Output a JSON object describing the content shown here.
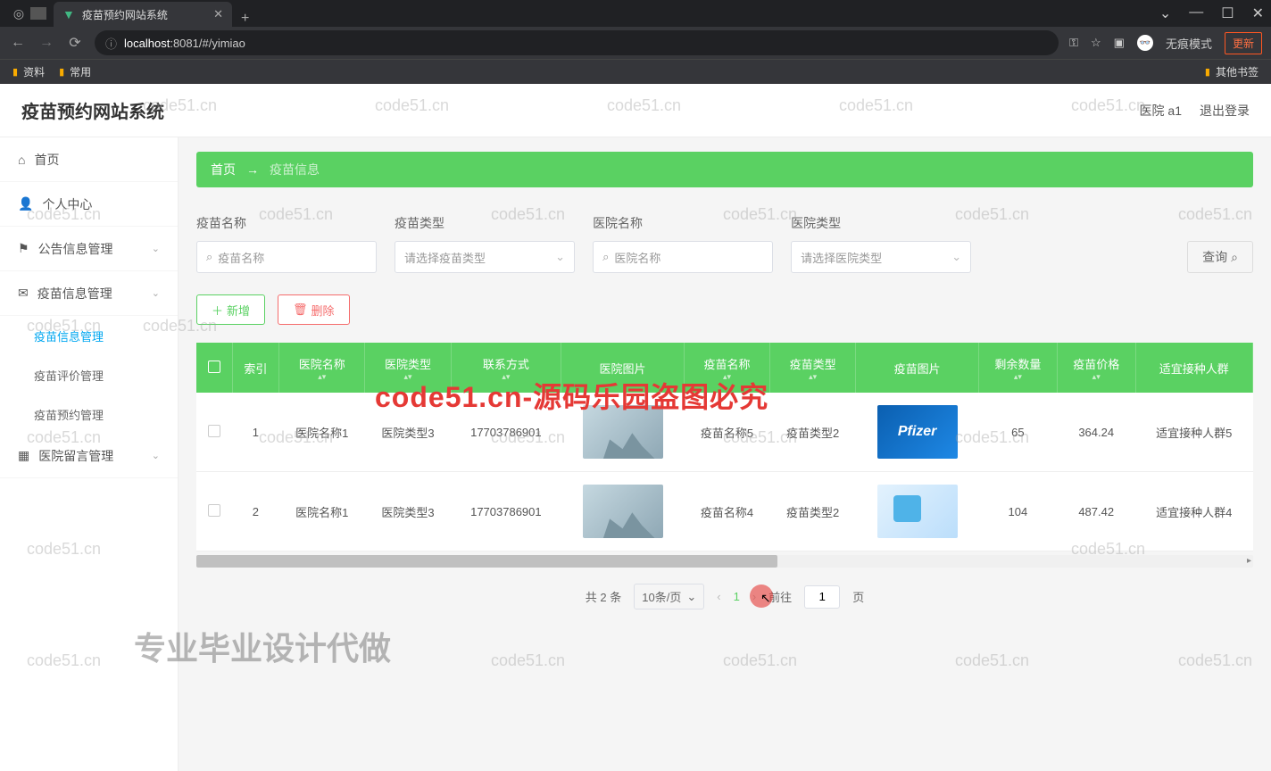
{
  "browser": {
    "tab_title": "疫苗预约网站系统",
    "url_prefix": "localhost",
    "url_port": ":8081",
    "url_path": "/#/yimiao",
    "incognito_label": "无痕模式",
    "update_label": "更新",
    "bookmarks": [
      "资料",
      "常用"
    ],
    "bookmark_other": "其他书签"
  },
  "header": {
    "title": "疫苗预约网站系统",
    "user": "医院 a1",
    "logout": "退出登录"
  },
  "sidebar": {
    "items": [
      {
        "icon": "⌂",
        "label": "首页"
      },
      {
        "icon": "👤",
        "label": "个人中心"
      },
      {
        "icon": "⚑",
        "label": "公告信息管理",
        "expand": true
      },
      {
        "icon": "✉",
        "label": "疫苗信息管理",
        "expand": true,
        "children": [
          "疫苗信息管理",
          "疫苗评价管理",
          "疫苗预约管理"
        ],
        "active_child": 0
      },
      {
        "icon": "▦",
        "label": "医院留言管理",
        "expand": true
      }
    ]
  },
  "breadcrumb": {
    "home": "首页",
    "arrow": "→",
    "current": "疫苗信息"
  },
  "filters": [
    {
      "label": "疫苗名称",
      "placeholder": "疫苗名称",
      "icon": "⌕",
      "type": "input"
    },
    {
      "label": "疫苗类型",
      "placeholder": "请选择疫苗类型",
      "type": "select"
    },
    {
      "label": "医院名称",
      "placeholder": "医院名称",
      "icon": "⌕",
      "type": "input"
    },
    {
      "label": "医院类型",
      "placeholder": "请选择医院类型",
      "type": "select"
    }
  ],
  "buttons": {
    "search": "查询",
    "add": "新增",
    "delete": "删除"
  },
  "table": {
    "headers": [
      "",
      "索引",
      "医院名称",
      "医院类型",
      "联系方式",
      "医院图片",
      "疫苗名称",
      "疫苗类型",
      "疫苗图片",
      "剩余数量",
      "疫苗价格",
      "适宜接种人群"
    ],
    "rows": [
      {
        "idx": "1",
        "hname": "医院名称1",
        "htype": "医院类型3",
        "phone": "17703786901",
        "vname": "疫苗名称5",
        "vtype": "疫苗类型2",
        "qty": "65",
        "price": "364.24",
        "crowd": "适宜接种人群5"
      },
      {
        "idx": "2",
        "hname": "医院名称1",
        "htype": "医院类型3",
        "phone": "17703786901",
        "vname": "疫苗名称4",
        "vtype": "疫苗类型2",
        "qty": "104",
        "price": "487.42",
        "crowd": "适宜接种人群4"
      }
    ]
  },
  "pagination": {
    "total": "共 2 条",
    "page_size": "10条/页",
    "current": "1",
    "goto_label": "前往",
    "goto_value": "1",
    "page_suffix": "页"
  },
  "watermarks": {
    "small": "code51.cn",
    "red": "code51.cn-源码乐园盗图必究",
    "gray_big": "专业毕业设计代做"
  }
}
